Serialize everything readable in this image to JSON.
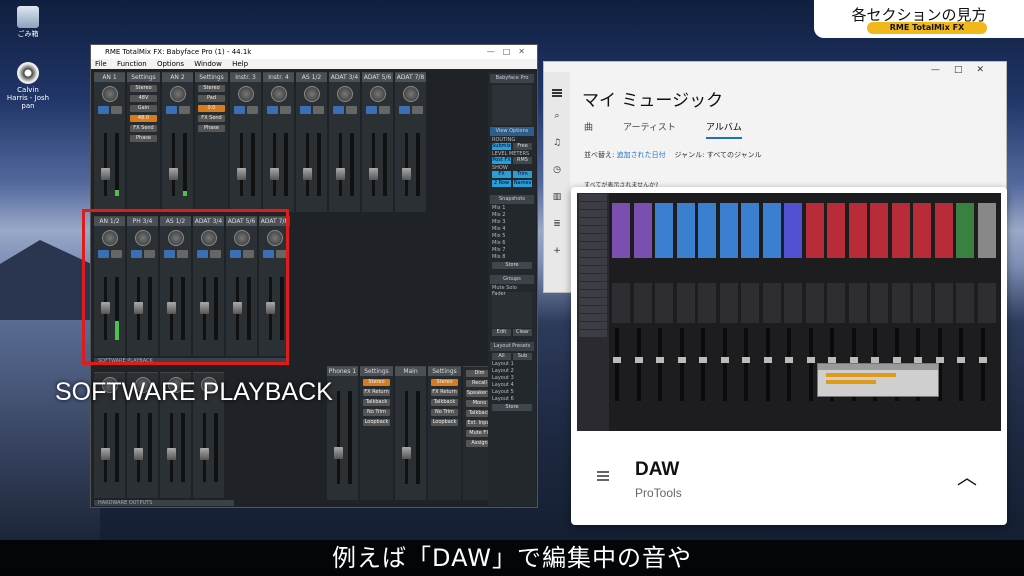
{
  "desktop": {
    "icons": [
      {
        "label": "ごみ箱",
        "icon": "recycle-bin-icon"
      },
      {
        "label": "Calvin Harris - Josh pan",
        "icon": "audio-file-icon"
      }
    ]
  },
  "totalmix": {
    "window_title": "RME TotalMix FX: Babyface Pro (1) - 44.1k",
    "menu": [
      "File",
      "Function",
      "Options",
      "Window",
      "Help"
    ],
    "inputs": [
      "AN 1",
      "AN 2",
      "Instr. 3",
      "Instr. 4",
      "AS 1/2",
      "ADAT 3/4",
      "ADAT 5/6",
      "ADAT 7/8"
    ],
    "input_settings_label": "Settings",
    "input_buttons": [
      "Stereo",
      "48V",
      "Pad",
      "Phase",
      "FX Send",
      "Gain"
    ],
    "playback": [
      "AN 1/2",
      "PH 3/4",
      "AS 1/2",
      "ADAT 3/4",
      "ADAT 5/6",
      "ADAT 7/8"
    ],
    "playback_section": "SOFTWARE PLAYBACK",
    "outputs_section": "HARDWARE OUTPUTS",
    "phones_label": "Phones 1",
    "main_label": "Main",
    "output_settings": "Settings",
    "output_buttons": [
      "Stereo",
      "FX Return",
      "Talkback",
      "No Trim",
      "Loopback"
    ],
    "right_buttons": [
      "Dim",
      "Recall",
      "Speaker B",
      "Mono",
      "Talkback",
      "Ext. Input",
      "Mute FX",
      "Assign"
    ],
    "device": "Babyface Pro",
    "view_options": "View Options",
    "routing_mode": "ROUTING MODE",
    "routing_buttons": [
      "Submix",
      "Free"
    ],
    "level_meters": "LEVEL METERS",
    "meter_buttons": [
      "Post FX",
      "RMS"
    ],
    "show": "SHOW",
    "show_buttons": [
      "FX",
      "Trim",
      "2 Row",
      "Names"
    ],
    "snapshots_label": "Snapshots",
    "snapshots": [
      "Mix 1",
      "Mix 2",
      "Mix 3",
      "Mix 4",
      "Mix 5",
      "Mix 6",
      "Mix 7",
      "Mix 8"
    ],
    "store": "Store",
    "groups_label": "Groups",
    "groups_header": "Mute  Solo  Fader",
    "groups_buttons": [
      "Edit",
      "Clear"
    ],
    "layout_label": "Layout Presets",
    "layout_tabs": [
      "All",
      "Sub"
    ],
    "layouts": [
      "Layout 1",
      "Layout 2",
      "Layout 3",
      "Layout 4",
      "Layout 5",
      "Layout 6"
    ],
    "fader_value": "0.0",
    "gain_value": "48.0"
  },
  "music": {
    "title": "マイ ミュージック",
    "tabs": [
      "曲",
      "アーティスト",
      "アルバム"
    ],
    "active_tab": "アルバム",
    "sort_label": "並べ替え:",
    "sort_value": "追加された日付",
    "genre_label": "ジャンル:",
    "genre_value": "すべてのジャンル",
    "missing_text": "すべてが表示されませんか?"
  },
  "now_playing": {
    "title": "DAW",
    "artist": "ProTools"
  },
  "overlay": {
    "heading": "各セクションの見方",
    "subheading": "RME TotalMix FX",
    "software_playback": "SOFTWARE PLAYBACK",
    "caption": "例えば「DAW」で編集中の音や"
  },
  "colors": {
    "highlight": "#e01b1b",
    "badge_accent": "#f2b71b",
    "link_blue": "#1f6fc5"
  }
}
